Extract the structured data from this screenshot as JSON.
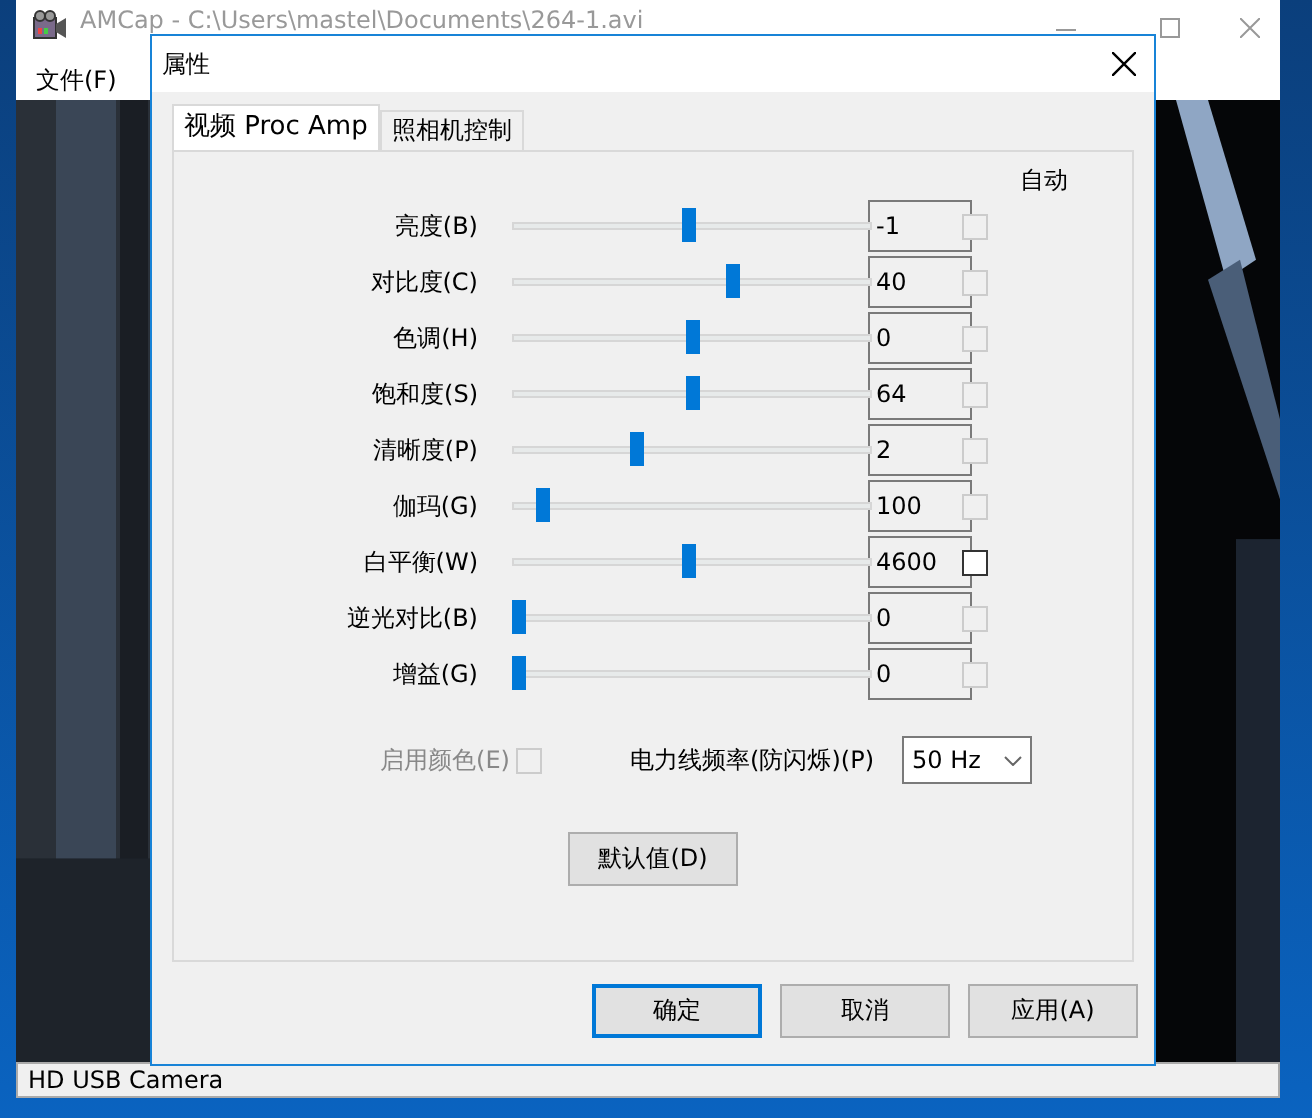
{
  "app_window": {
    "title": "AMCap - C:\\Users\\mastel\\Documents\\264-1.avi",
    "menu": [
      "文件(F)"
    ],
    "status_bar": "HD USB Camera"
  },
  "dialog": {
    "title": "属性",
    "tabs": [
      {
        "label": "视频 Proc Amp",
        "selected": true
      },
      {
        "label": "照相机控制",
        "selected": false
      }
    ],
    "auto_header": "自动",
    "controls": [
      {
        "label": "亮度(B)",
        "level": 0.49,
        "value": "-1",
        "auto_checked": false,
        "auto_disabled": true
      },
      {
        "label": "对比度(C)",
        "level": 0.62,
        "value": "40",
        "auto_checked": false,
        "auto_disabled": true
      },
      {
        "label": "色调(H)",
        "level": 0.5,
        "value": "0",
        "auto_checked": false,
        "auto_disabled": true
      },
      {
        "label": "饱和度(S)",
        "level": 0.5,
        "value": "64",
        "auto_checked": false,
        "auto_disabled": true
      },
      {
        "label": "清晰度(P)",
        "level": 0.34,
        "value": "2",
        "auto_checked": false,
        "auto_disabled": true
      },
      {
        "label": "伽玛(G)",
        "level": 0.07,
        "value": "100",
        "auto_checked": false,
        "auto_disabled": true
      },
      {
        "label": "白平衡(W)",
        "level": 0.49,
        "value": "4600",
        "auto_checked": false,
        "auto_disabled": false
      },
      {
        "label": "逆光对比(B)",
        "level": 0.0,
        "value": "0",
        "auto_checked": false,
        "auto_disabled": true
      },
      {
        "label": "增益(G)",
        "level": 0.0,
        "value": "0",
        "auto_checked": false,
        "auto_disabled": true
      }
    ],
    "enable_color": {
      "label": "启用颜色(E)",
      "checked": false,
      "disabled": true
    },
    "power_line": {
      "label": "电力线频率(防闪烁)(P)",
      "value": "50 Hz"
    },
    "default_button": "默认值(D)",
    "buttons": [
      {
        "label": "确定",
        "default": true
      },
      {
        "label": "取消",
        "default": false
      },
      {
        "label": "应用(A)",
        "default": false
      }
    ]
  }
}
